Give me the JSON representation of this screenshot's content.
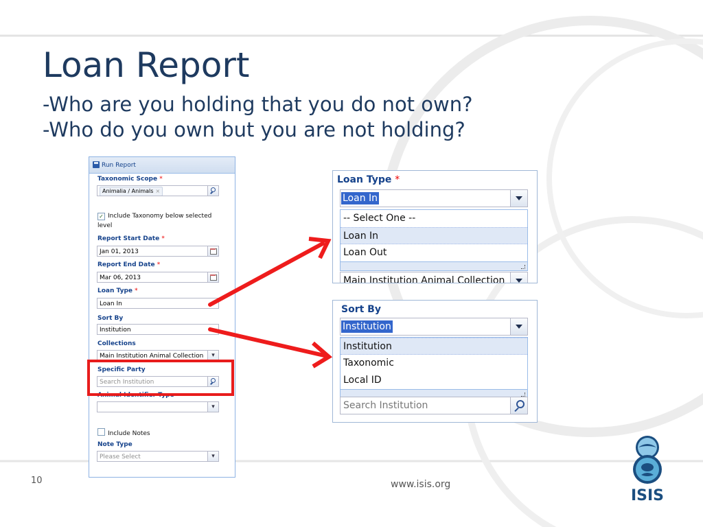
{
  "slide": {
    "title": "Loan Report",
    "subtitle_1": "-Who are you holding that you do not own?",
    "subtitle_2": "-Who do you own but you are not holding?",
    "page_number": "10",
    "footer_url": "www.isis.org",
    "logo_text": "ISIS"
  },
  "form": {
    "header_label": "Run Report",
    "taxonomic_scope": {
      "label": "Taxonomic Scope",
      "required_mark": "*",
      "chip": "Animalia / Animals",
      "chip_remove": "×"
    },
    "include_taxonomy": {
      "label_1": "Include Taxonomy below selected",
      "label_2": "level",
      "checked": "✓"
    },
    "start_date": {
      "label": "Report Start Date",
      "required_mark": "*",
      "value": "Jan 01, 2013"
    },
    "end_date": {
      "label": "Report End Date",
      "required_mark": "*",
      "value": "Mar 06, 2013"
    },
    "loan_type": {
      "label": "Loan Type",
      "required_mark": "*",
      "value": "Loan In"
    },
    "sort_by": {
      "label": "Sort By",
      "value": "Institution"
    },
    "collections": {
      "label": "Collections",
      "value": "Main Institution Animal Collection"
    },
    "specific_party": {
      "label": "Specific Party",
      "placeholder": "Search Institution"
    },
    "animal_identifier_type": {
      "label": "Animal Identifier Type",
      "value": ""
    },
    "include_notes": {
      "label": "Include Notes"
    },
    "note_type": {
      "label": "Note Type",
      "placeholder": "Please Select"
    }
  },
  "loan_zoom": {
    "label": "Loan Type",
    "required_mark": "*",
    "selected": "Loan In",
    "options": [
      "-- Select One --",
      "Loan In",
      "Loan Out"
    ],
    "behind_value": "Main Institution Animal Collection"
  },
  "sort_zoom": {
    "label": "Sort By",
    "selected": "Institution",
    "options": [
      "Institution",
      "Taxonomic",
      "Local ID"
    ],
    "behind_placeholder": "Search Institution"
  },
  "colors": {
    "title": "#1e3a5f",
    "form_label": "#15428b",
    "highlight_red": "#e81c1c",
    "selection_blue": "#3366cc"
  },
  "icons": [
    "save-icon",
    "search-icon",
    "calendar-icon",
    "chevron-down-icon",
    "checkbox-icon",
    "arrow-icon",
    "isis-logo-icon"
  ]
}
